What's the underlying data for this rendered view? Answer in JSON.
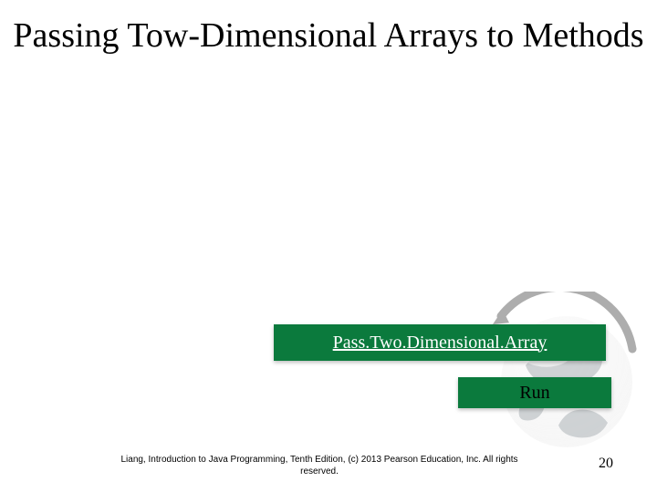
{
  "title": "Passing Tow-Dimensional Arrays to Methods",
  "code_button": {
    "label": "Pass.Two.Dimensional.Array",
    "icon": "document-icon"
  },
  "run_button": {
    "label": "Run"
  },
  "footer": {
    "citation": "Liang, Introduction to Java Programming, Tenth Edition, (c) 2013 Pearson Education, Inc. All rights reserved.",
    "page_number": "20"
  },
  "colors": {
    "pill_green": "#0b7a3d",
    "icon_olive": "#7a9c3a"
  }
}
